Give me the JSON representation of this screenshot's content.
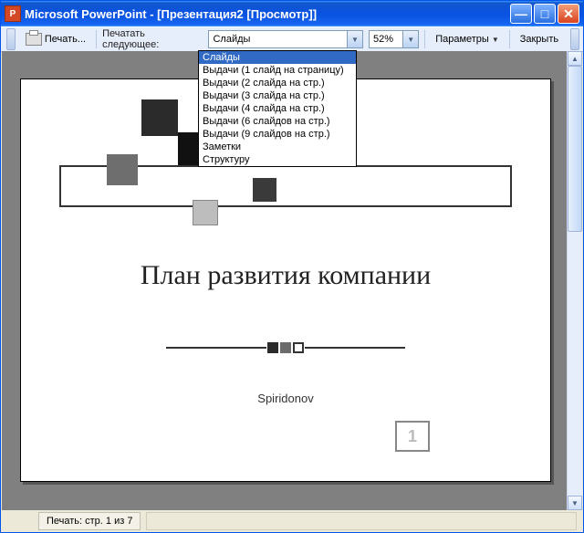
{
  "titlebar": {
    "app_icon_letter": "P",
    "title": "Microsoft PowerPoint - [Презентация2 [Просмотр]]"
  },
  "toolbar": {
    "print_label": "Печать...",
    "print_what_label": "Печатать следующее:",
    "print_what_selected": "Слайды",
    "zoom_value": "52%",
    "options_label": "Параметры",
    "close_label": "Закрыть"
  },
  "print_what_options": [
    "Слайды",
    "Выдачи (1 слайд на страницу)",
    "Выдачи (2 слайда на стр.)",
    "Выдачи (3 слайда на стр.)",
    "Выдачи (4 слайда на стр.)",
    "Выдачи (6 слайдов на стр.)",
    "Выдачи (9 слайдов на стр.)",
    "Заметки",
    "Структуру"
  ],
  "print_what_selected_index": 0,
  "slide": {
    "title": "План развития компании",
    "author": "Spiridonov",
    "page_number": "1"
  },
  "status": {
    "print_pages": "Печать: стр. 1 из 7"
  },
  "glyphs": {
    "dropdown_arrow": "▼",
    "up_arrow": "▲",
    "down_arrow": "▼",
    "minimize": "—",
    "maximize": "□",
    "close": "✕"
  }
}
